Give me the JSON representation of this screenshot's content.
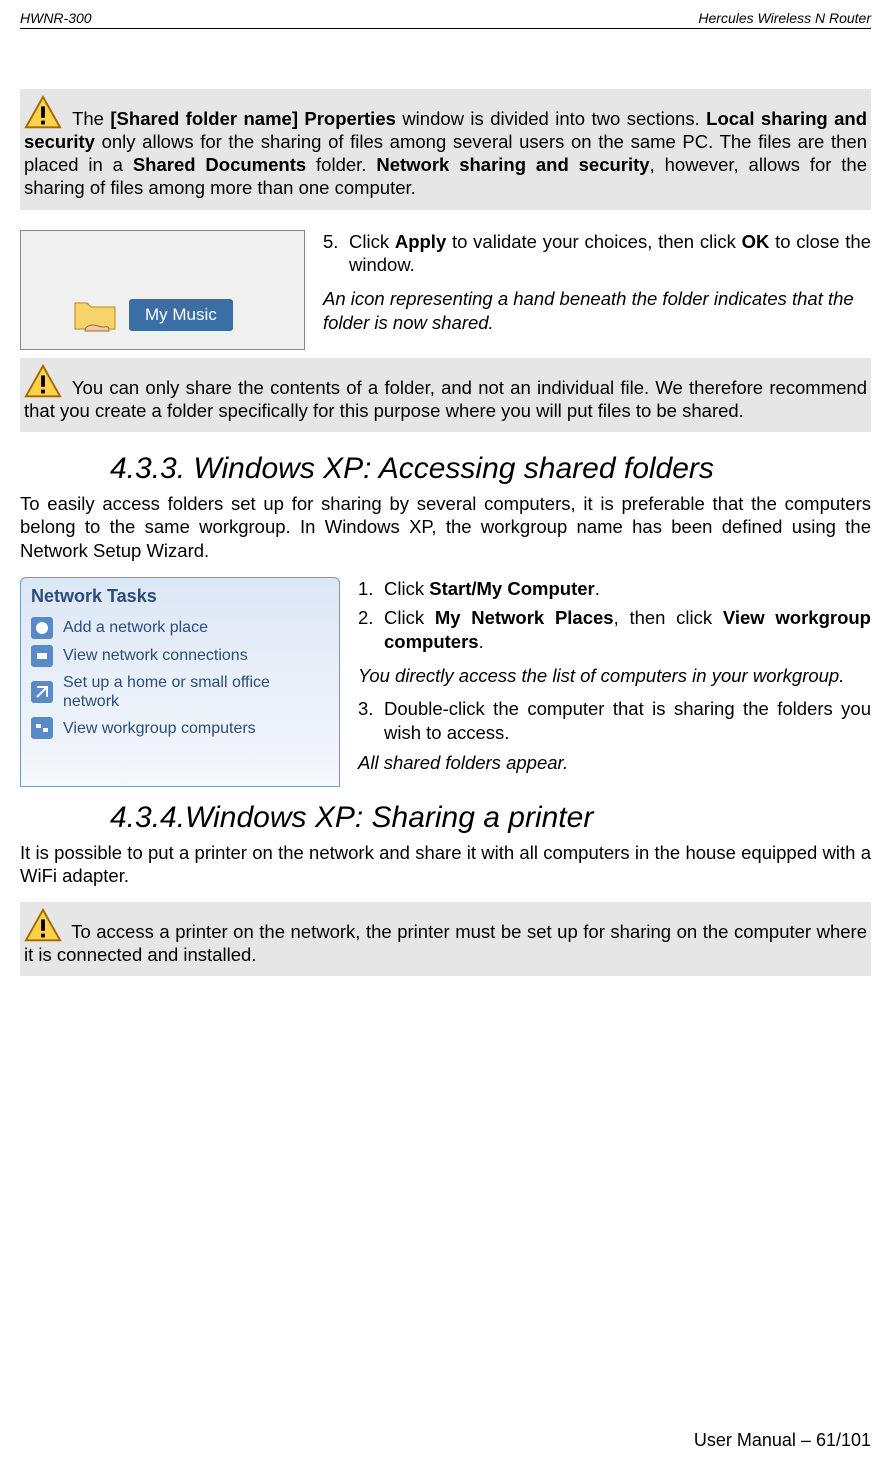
{
  "header": {
    "left": "HWNR-300",
    "right": "Hercules Wireless N Router"
  },
  "callout1": {
    "pre": " The ",
    "b1": "[Shared folder name] Properties",
    "t1": " window is divided into two sections.  ",
    "b2": "Local sharing and security",
    "t2": " only allows for the sharing of files among several users on the same PC.  The files are then placed in a ",
    "b3": "Shared Documents",
    "t3": " folder.  ",
    "b4": "Network sharing and security",
    "t4": ", however, allows for the sharing of files among more than one computer."
  },
  "mymusic_label": "My Music",
  "step5": {
    "n": "5.",
    "pre": "Click ",
    "b1": "Apply",
    "mid": " to validate your choices, then click ",
    "b2": "OK",
    "post": " to close the window."
  },
  "step5_note": "An icon representing a hand beneath the folder indicates that the folder is now shared.",
  "callout2": " You can only share the contents of a folder, and not an individual file.  We therefore recommend that you create a folder specifically for this purpose where you will put files to be shared.",
  "h433": "4.3.3. Windows XP: Accessing shared folders",
  "p433": "To easily access folders set up for sharing by several computers, it is preferable that the computers belong to the same workgroup.  In Windows XP, the workgroup name has been defined using the Network Setup Wizard.",
  "nt": {
    "title": "Network Tasks",
    "i1": "Add a network place",
    "i2": "View network connections",
    "i3": "Set up a home or small office network",
    "i4": "View workgroup computers"
  },
  "steps433": {
    "s1n": "1.",
    "s1pre": "Click ",
    "s1b": "Start/My Computer",
    "s1post": ".",
    "s2n": "2.",
    "s2pre": "Click ",
    "s2b1": "My Network Places",
    "s2mid": ", then click ",
    "s2b2": "View workgroup computers",
    "s2post": ".",
    "note1": "You directly access the list of computers in your workgroup.",
    "s3n": "3.",
    "s3txt": "Double-click the computer that is sharing the folders you wish to access.",
    "note2": "All shared folders appear."
  },
  "h434": "4.3.4.Windows XP: Sharing a printer",
  "p434": "It is possible to put a printer on the network and share it with all computers in the house equipped with a WiFi adapter.",
  "callout3": " To access a printer on the network, the printer must be set up for sharing on the computer where it is connected and installed.",
  "footer": "User Manual – 61/101"
}
